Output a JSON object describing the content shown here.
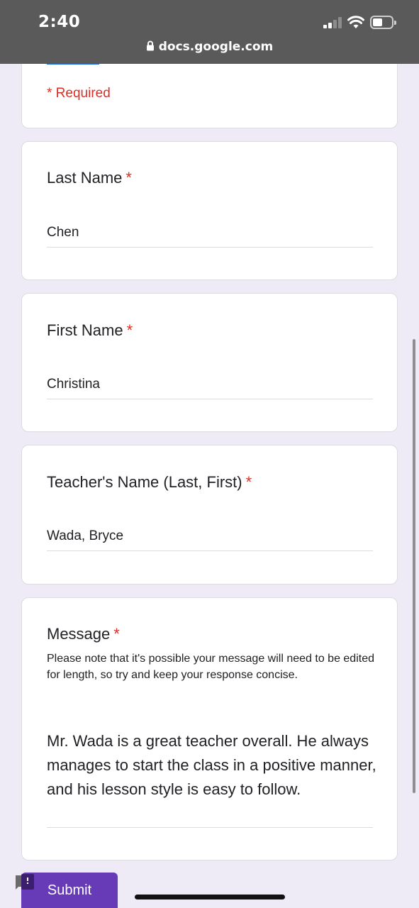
{
  "status_bar": {
    "time": "2:40",
    "signal_icon": "cellular-signal-icon",
    "wifi_icon": "wifi-icon",
    "battery_icon": "battery-icon"
  },
  "browser": {
    "url": "docs.google.com",
    "lock_icon": "lock-icon"
  },
  "form": {
    "required_note": "* Required",
    "questions": [
      {
        "title": "Last Name",
        "required_mark": "*",
        "answer": "Chen"
      },
      {
        "title": "First Name",
        "required_mark": "*",
        "answer": "Christina"
      },
      {
        "title": "Teacher's Name (Last, First)",
        "required_mark": "*",
        "answer": "Wada, Bryce"
      },
      {
        "title": "Message",
        "required_mark": "*",
        "description": "Please note that it's possible your message will need to be edited for length, so try and keep your response concise.",
        "answer": "Mr. Wada is a great teacher overall. He always manages to start the class in a positive manner, and his lesson style is easy to follow."
      }
    ],
    "submit_label": "Submit"
  },
  "colors": {
    "accent": "#673ab7",
    "required": "#d93025",
    "background": "#efebf6",
    "status_bar": "#5a5a5a"
  }
}
